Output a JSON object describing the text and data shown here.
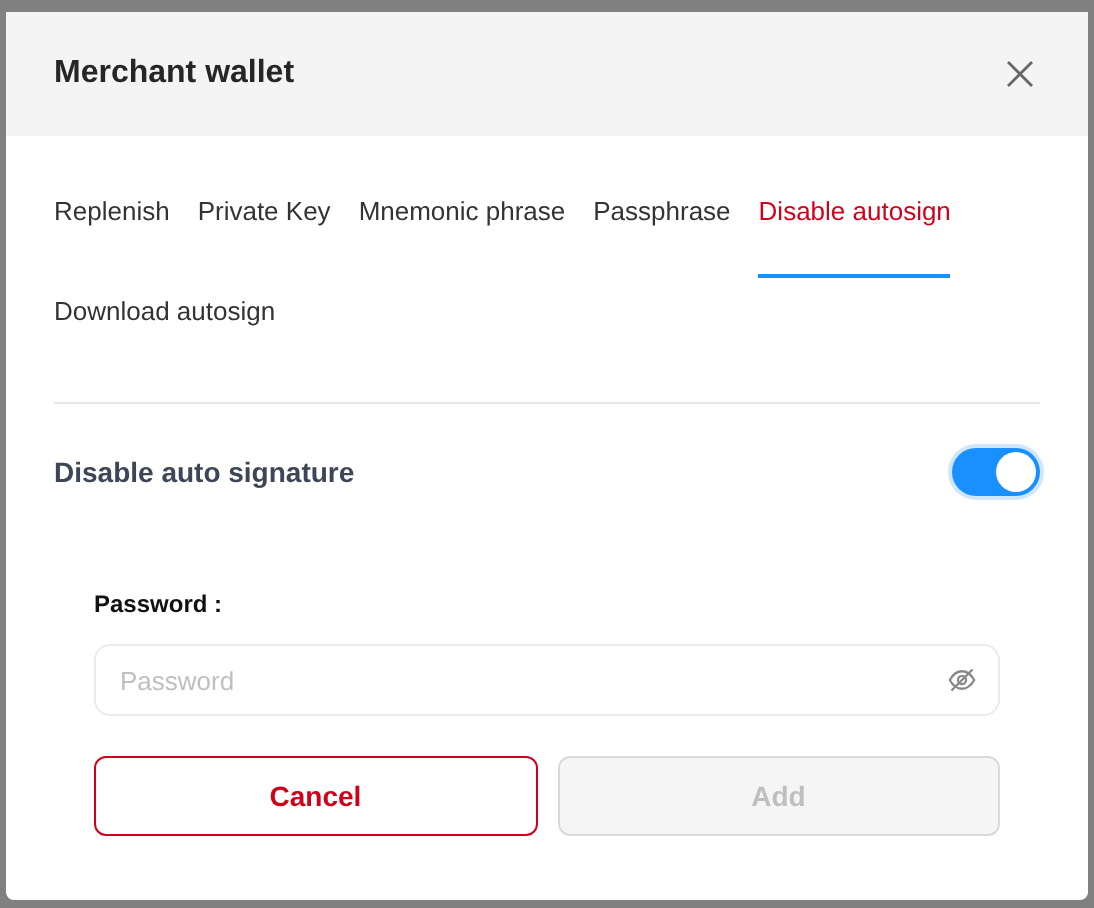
{
  "dialog": {
    "title": "Merchant wallet"
  },
  "tabs": [
    {
      "label": "Replenish",
      "selected": false
    },
    {
      "label": "Private Key",
      "selected": false
    },
    {
      "label": "Mnemonic phrase",
      "selected": false
    },
    {
      "label": "Passphrase",
      "selected": false
    },
    {
      "label": "Disable autosign",
      "selected": true
    },
    {
      "label": "Download autosign",
      "selected": false
    }
  ],
  "setting": {
    "label": "Disable auto signature",
    "on": true
  },
  "password": {
    "label": "Password :",
    "placeholder": "Password"
  },
  "buttons": [
    {
      "label": "Cancel",
      "disabled": false,
      "kind": "secondary"
    },
    {
      "label": "Add",
      "disabled": true,
      "kind": "primary"
    }
  ]
}
